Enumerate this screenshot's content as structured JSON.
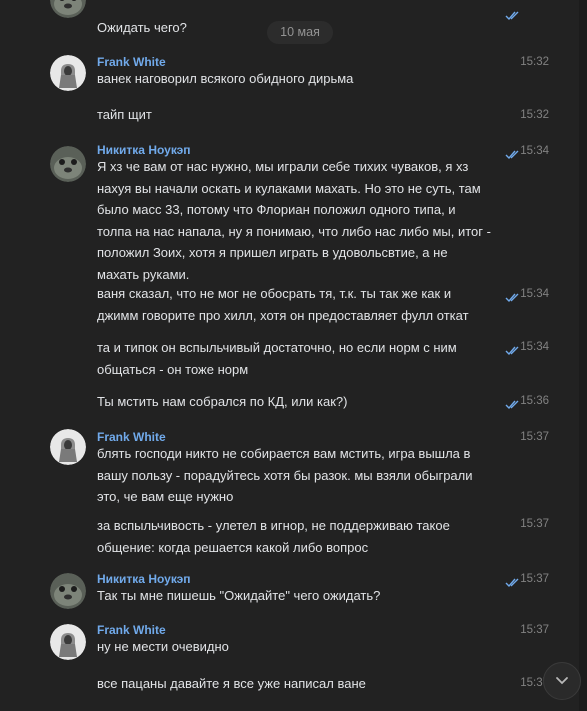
{
  "date_separator": "10 мая",
  "messages": [
    {
      "author": "",
      "text": "Ожидать чего?",
      "time": ""
    },
    {
      "author": "Frank White",
      "text": "ванек наговорил всякого обидного дирьма",
      "time": "15:32"
    },
    {
      "author": "",
      "text": "тайп щит",
      "time": "15:32"
    },
    {
      "author": "Никитка Ноукэп",
      "text": "Я хз че вам от нас нужно, мы играли себе тихих чуваков, я хз нахуя вы начали оскать и кулаками махать. Но это не суть, там было масс 33, потому что Флориан положил одного типа, и толпа на нас напала, ну я понимаю, что либо нас либо мы, итог - положил Зоих, хотя я пришел играть в удовольсвтие, а не махать руками.",
      "time": "15:34"
    },
    {
      "author": "",
      "text": "ваня сказал, что не мог не обосрать тя, т.к. ты так же как и джимм говорите про хилл, хотя он предоставляет фулл откат",
      "time": "15:34"
    },
    {
      "author": "",
      "text": "та и типок он вспыльчивый достаточно, но если норм с ним общаться - он тоже норм",
      "time": "15:34"
    },
    {
      "author": "",
      "text": "Ты мстить нам собрался по КД, или как?)",
      "time": "15:36"
    },
    {
      "author": "Frank White",
      "text": "блять господи никто не собирается вам мстить, игра вышла в вашу пользу - порадуйтесь хотя бы разок. мы взяли обыграли это, че вам еще нужно",
      "time": "15:37"
    },
    {
      "author": "",
      "text": "за вспыльчивость - улетел в игнор, не поддерживаю такое общение: когда решается какой либо вопрос",
      "time": "15:37"
    },
    {
      "author": "Никитка Ноукэп",
      "text": "Так ты мне пишешь \"Ожидайте\" чего ожидать?",
      "time": "15:37"
    },
    {
      "author": "Frank White",
      "text": "ну не мести очевидно",
      "time": "15:37"
    },
    {
      "author": "",
      "text": "все пацаны давайте я все уже написал ване",
      "time": "15:37"
    }
  ]
}
